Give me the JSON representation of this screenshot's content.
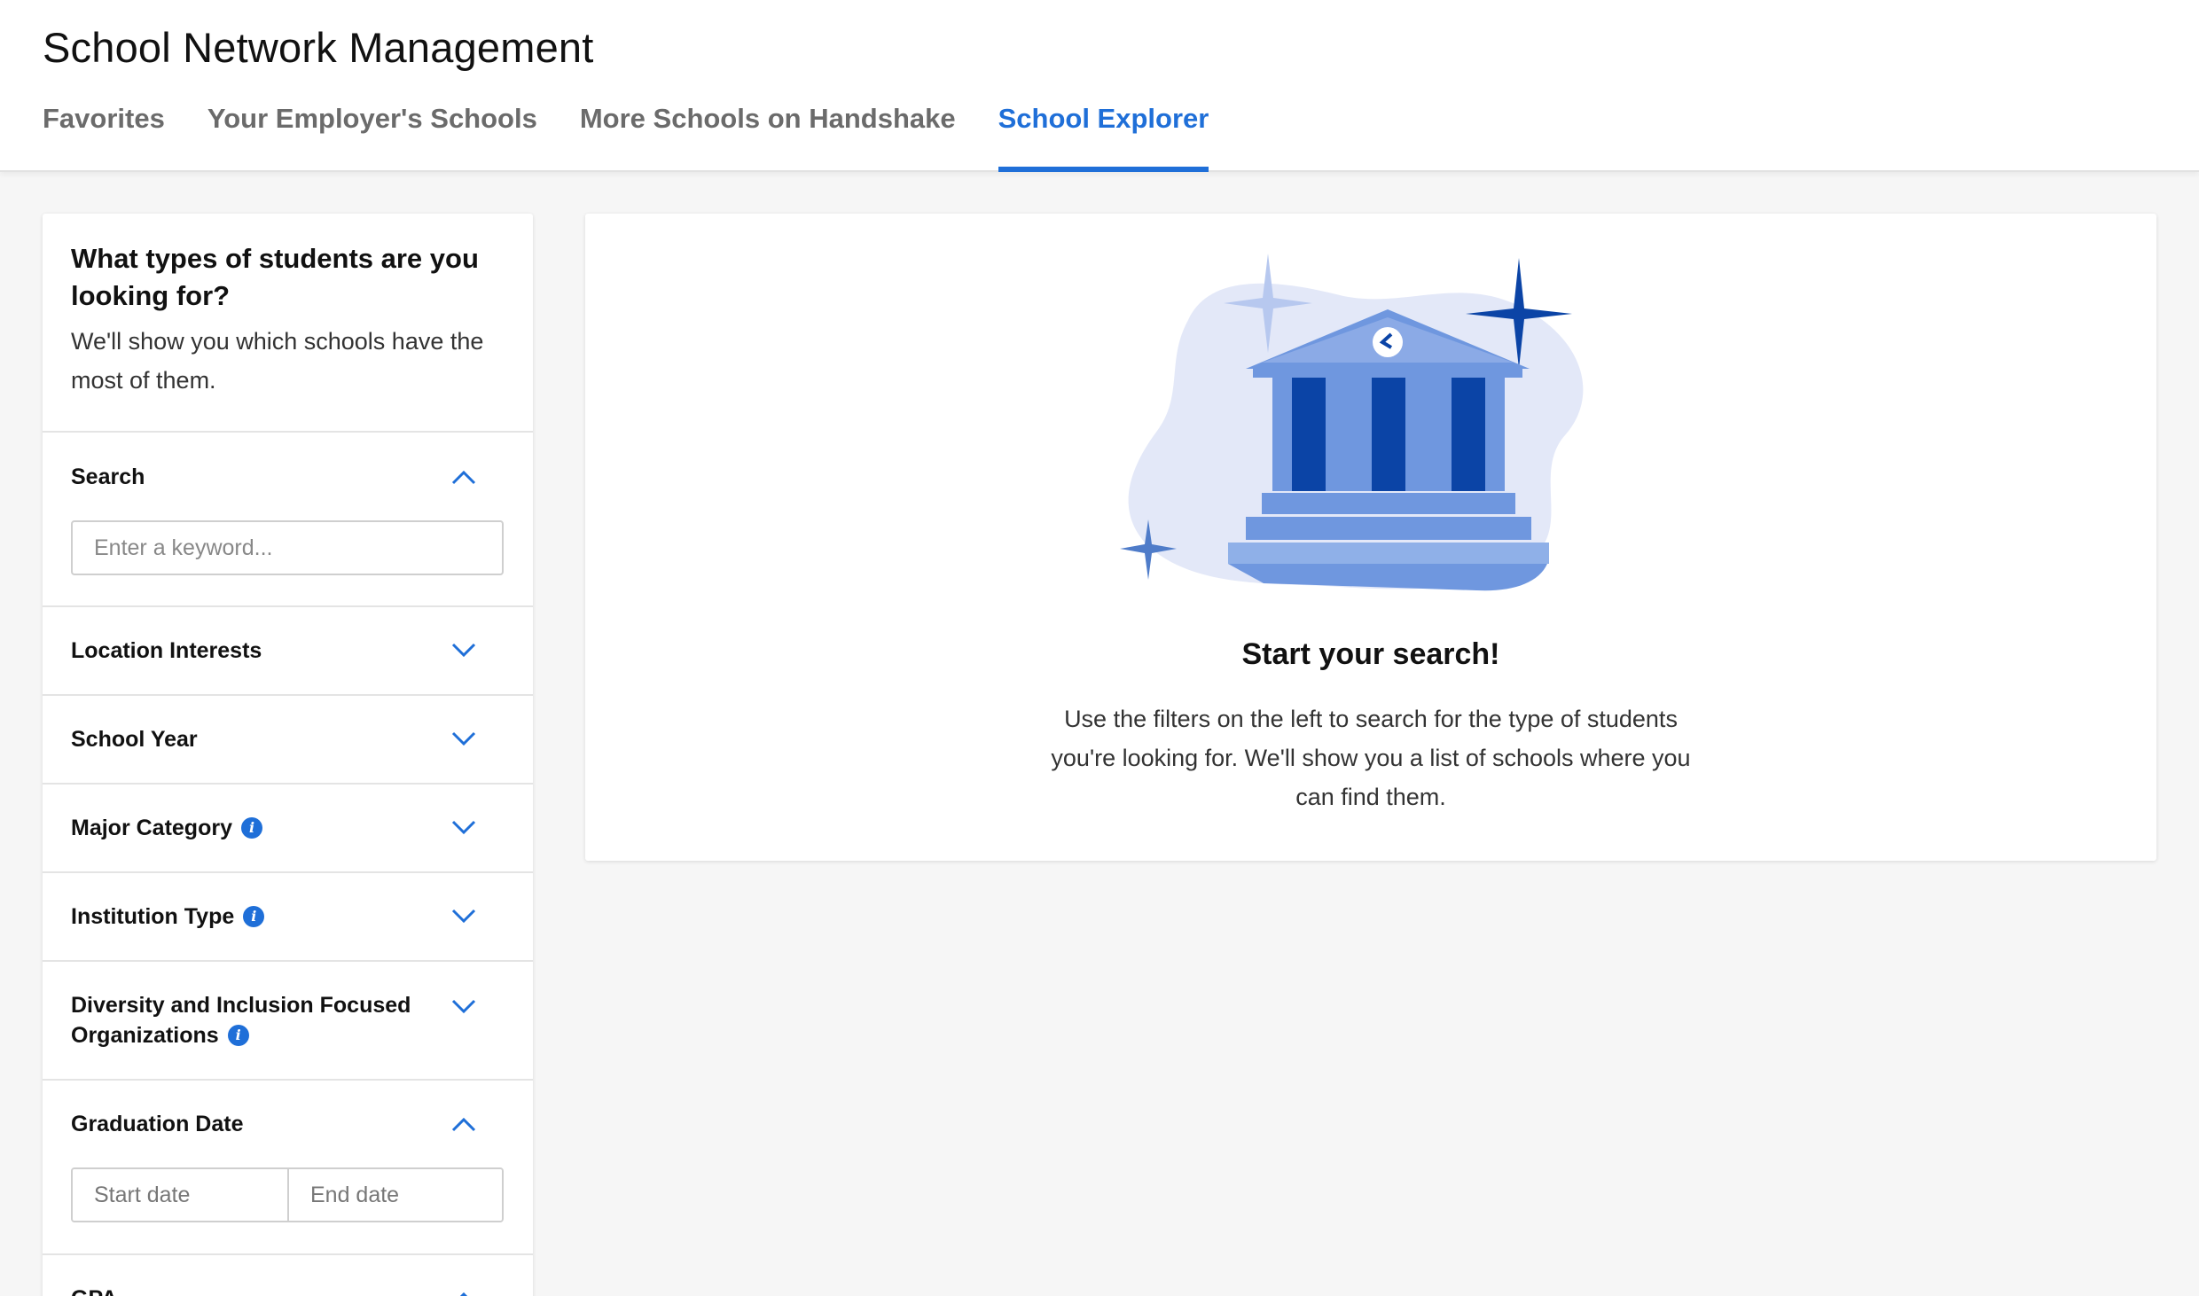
{
  "header": {
    "title": "School Network Management",
    "tabs": [
      {
        "label": "Favorites",
        "active": false
      },
      {
        "label": "Your Employer's Schools",
        "active": false
      },
      {
        "label": "More Schools on Handshake",
        "active": false
      },
      {
        "label": "School Explorer",
        "active": true
      }
    ]
  },
  "sidebar": {
    "intro_title": "What types of students are you looking for?",
    "intro_sub": "We'll show you which schools have the most of them.",
    "search": {
      "label": "Search",
      "placeholder": "Enter a keyword...",
      "value": "",
      "expanded": true
    },
    "location": {
      "label": "Location Interests",
      "expanded": false
    },
    "school_year": {
      "label": "School Year",
      "expanded": false
    },
    "major": {
      "label": "Major Category",
      "expanded": false
    },
    "institution": {
      "label": "Institution Type",
      "expanded": false
    },
    "diversity": {
      "label_line1": "Diversity and Inclusion Focused",
      "label_line2": "Organizations",
      "expanded": false
    },
    "graduation": {
      "label": "Graduation Date",
      "start_placeholder": "Start date",
      "end_placeholder": "End date",
      "expanded": true
    },
    "gpa": {
      "label": "GPA",
      "expanded": true
    }
  },
  "main": {
    "empty_title": "Start your search!",
    "empty_body": "Use the filters on the left to search for the type of students you're looking for. We'll show you a list of schools where you can find them.",
    "illustration_icon": "school-building-icon"
  },
  "colors": {
    "accent": "#1f6fd8",
    "illustration_light": "#e3e8f8",
    "illustration_mid": "#6f97df",
    "illustration_dark": "#0b44a6"
  }
}
